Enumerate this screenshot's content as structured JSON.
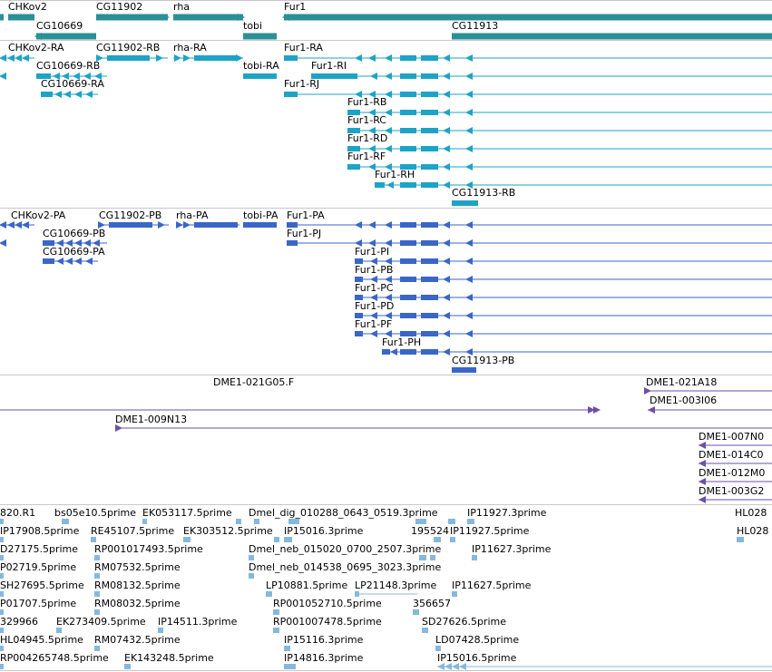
{
  "colors": {
    "gene": "#2a8f96",
    "mrna": "#1ea3c7",
    "protein": "#3a66c7",
    "est_clone": "#6b4fa8",
    "est": "#86b8dc",
    "separator": "#c8c8c8"
  },
  "labels": {
    "gene": [
      "CHKov2",
      "CG10669",
      "CG11902",
      "rha",
      "tobi",
      "Fur1",
      "CG11913"
    ],
    "mrna": [
      "CHKov2-RA",
      "CG11902-RB",
      "rha-RA",
      "tobi-RA",
      "Fur1-RA",
      "CG10669-RB",
      "Fur1-RI",
      "CG10669-RA",
      "Fur1-RJ",
      "Fur1-RB",
      "Fur1-RC",
      "Fur1-RD",
      "Fur1-RF",
      "Fur1-RH",
      "CG11913-RB"
    ],
    "protein": [
      "CHKov2-PA",
      "CG11902-PB",
      "rha-PA",
      "tobi-PA",
      "Fur1-PA",
      "CG10669-PB",
      "Fur1-PJ",
      "CG10669-PA",
      "Fur1-PI",
      "Fur1-PB",
      "Fur1-PC",
      "Fur1-PD",
      "Fur1-PF",
      "Fur1-PH",
      "CG11913-PB"
    ],
    "clone": [
      "DME1-021G05.F",
      "DME1-021A18",
      "DME1-003I06",
      "DME1-009N13",
      "DME1-007N0",
      "DME1-014C0",
      "DME1-012M0",
      "DME1-003G2"
    ],
    "est": [
      "820.R1",
      "bs05e10.5prime",
      "EK053117.5prime",
      "Dmel_dig_010288_0643_0519.3prime",
      "IP11927.3prime",
      "HL028",
      "IP17908.5prime",
      "RE45107.5prime",
      "EK303512.5prime",
      "IP15016.3prime",
      "195524",
      "IP11927.5prime",
      "HL028",
      "D27175.5prime",
      "RP001017493.5prime",
      "Dmel_neb_015020_0700_2507.3prime",
      "IP11627.3prime",
      "P02719.5prime",
      "RM07532.5prime",
      "Dmel_neb_014538_0695_3023.3prime",
      "SH27695.5prime",
      "RM08132.5prime",
      "LP10881.5prime",
      "LP21148.3prime",
      "IP11627.5prime",
      "P01707.5prime",
      "RM08032.5prime",
      "RP001052710.5prime",
      "356657",
      "329966",
      "EK273409.5prime",
      "IP14511.3prime",
      "RP001007478.5prime",
      "SD27626.5prime",
      "HL04945.5prime",
      "RM07432.5prime",
      "IP15116.3prime",
      "LD07428.5prime",
      "RP004265748.5prime",
      "EK143248.5prime",
      "IP14816.3prime",
      "IP15016.5prime"
    ]
  }
}
